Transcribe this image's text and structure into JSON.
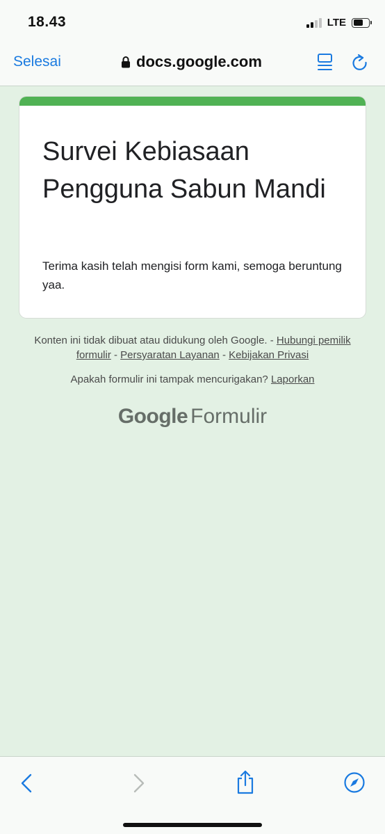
{
  "status": {
    "time": "18.43",
    "network": "LTE"
  },
  "browser": {
    "done_label": "Selesai",
    "url": "docs.google.com",
    "icons": {
      "lock": "lock-icon",
      "reader": "reader-icon",
      "reload": "reload-icon"
    }
  },
  "form": {
    "title": "Survei Kebiasaan Pengguna Sabun Mandi",
    "description": "Terima kasih telah mengisi form kami, semoga beruntung yaa."
  },
  "footer": {
    "disclaimer": "Konten ini tidak dibuat atau didukung oleh Google. - ",
    "contact_link": "Hubungi pemilik formulir",
    "sep": " - ",
    "terms_link": "Persyaratan Layanan",
    "privacy_link": "Kebijakan Privasi",
    "suspicious_text": "Apakah formulir ini tampak mencurigakan? ",
    "report_link": "Laporkan"
  },
  "brand": {
    "google": "Google",
    "product": "Formulir"
  },
  "toolbar": {
    "icons": [
      "back-icon",
      "forward-icon",
      "share-icon",
      "compass-icon"
    ]
  },
  "colors": {
    "accent": "#50b254",
    "link_blue": "#1a7ae0",
    "background": "#e3f1e4"
  }
}
